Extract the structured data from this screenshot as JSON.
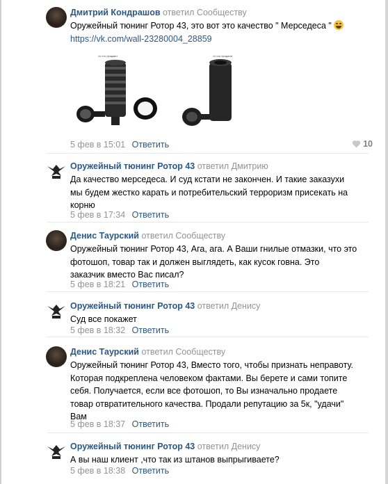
{
  "comments": [
    {
      "author": "Дмитрий Кондрашов",
      "replied_to": "ответил Сообществу",
      "text": "Оружейный тюнинг Ротор 43, это вот это качество \" Мерседеса \"",
      "link": "https://vk.com/wall-23280004_28859",
      "image_caption_1": "то что продают",
      "image_caption_2": "то что продали",
      "date": "5 фев в 15:01",
      "reply_label": "Ответить",
      "likes": "10"
    },
    {
      "author": "Оружейный тюнинг Ротор 43",
      "replied_to": "ответил Дмитрию",
      "line1": "Да качество мерседеса. И суд кстати не закончен. И такие заказухи",
      "line2": "мы будем жестко карать и потребительский терроризм присекать на",
      "line3": "корню",
      "date": "5 фев в 17:34",
      "reply_label": "Ответить"
    },
    {
      "author": "Денис Таурский",
      "replied_to": "ответил Сообществу",
      "line1": "Оружейный тюнинг Ротор 43, Ага, ага. А Ваши гнилые отмазки, что это",
      "line2": "фотошоп, товар так и должен выглядеть, как кусок говна. Это",
      "line3": "заказчик вместо Вас писал?",
      "date": "5 фев в 18:21",
      "reply_label": "Ответить"
    },
    {
      "author": "Оружейный тюнинг Ротор 43",
      "replied_to": "ответил Денису",
      "line1": "Суд все покажет",
      "date": "5 фев в 18:32",
      "reply_label": "Ответить"
    },
    {
      "author": "Денис Таурский",
      "replied_to": "ответил Сообществу",
      "line1": "Оружейный тюнинг Ротор 43, Вместо того, чтобы признать неправоту.",
      "line2": "Которая подкреплена человеком фактами. Вы берете и сами топите",
      "line3": "себя. Получается, если все фотошоп, то Вы изначально продаете",
      "line4": "товар отвратительного качества. Продали репутацию за 5к, \"удачи\"",
      "line5": "Вам",
      "date": "5 фев в 18:37",
      "reply_label": "Ответить"
    },
    {
      "author": "Оружейный тюнинг Ротор 43",
      "replied_to": "ответил Денису",
      "line1": "А вы наш клиент ,что так из штанов выпрыгиваете?",
      "date": "5 фев в 18:38",
      "reply_label": "Ответить"
    }
  ],
  "icons": {
    "like": "heart-icon",
    "emoji": "grinning-squint-emoji-icon",
    "community_logo": "rotor43-logo-icon"
  }
}
